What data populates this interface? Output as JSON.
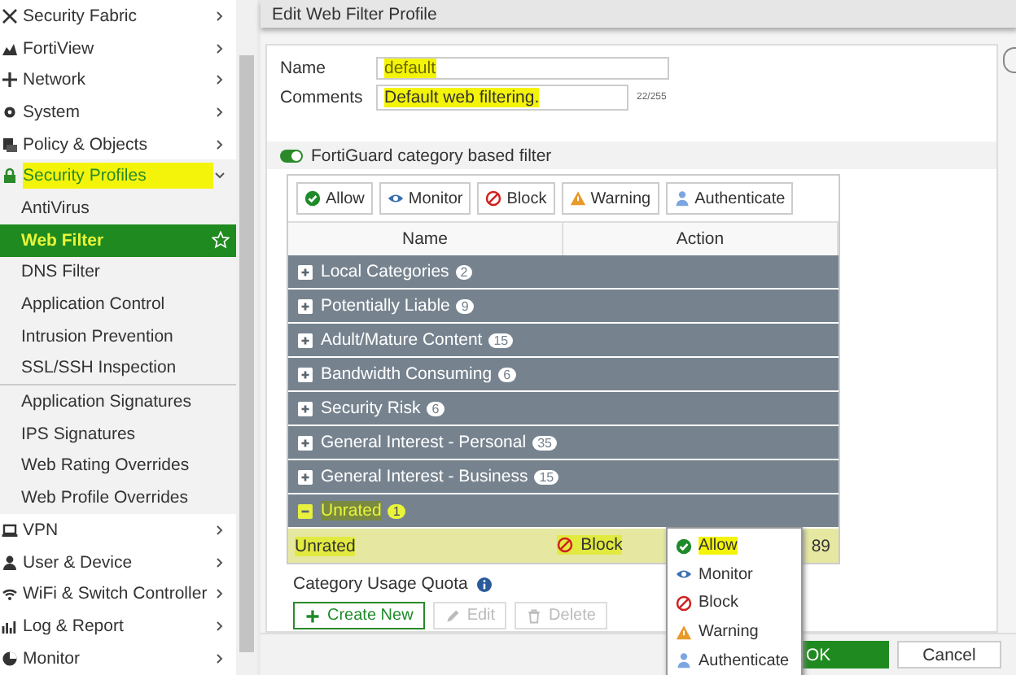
{
  "sidebar": {
    "items": [
      {
        "label": "Security Fabric",
        "expanded": false,
        "highlighted": false
      },
      {
        "label": "FortiView",
        "expanded": false,
        "highlighted": false
      },
      {
        "label": "Network",
        "expanded": false,
        "highlighted": false
      },
      {
        "label": "System",
        "expanded": false,
        "highlighted": false
      },
      {
        "label": "Policy & Objects",
        "expanded": false,
        "highlighted": false
      },
      {
        "label": "Security Profiles",
        "expanded": true,
        "highlighted": true,
        "children": [
          {
            "label": "AntiVirus",
            "selected": false,
            "highlighted": false,
            "separator_before": false
          },
          {
            "label": "Web Filter",
            "selected": true,
            "highlighted": true,
            "separator_before": false
          },
          {
            "label": "DNS Filter",
            "selected": false,
            "highlighted": false,
            "separator_before": false
          },
          {
            "label": "Application Control",
            "selected": false,
            "highlighted": false,
            "separator_before": false
          },
          {
            "label": "Intrusion Prevention",
            "selected": false,
            "highlighted": false,
            "separator_before": false
          },
          {
            "label": "SSL/SSH Inspection",
            "selected": false,
            "highlighted": false,
            "separator_before": false
          },
          {
            "label": "Application Signatures",
            "selected": false,
            "highlighted": false,
            "separator_before": true
          },
          {
            "label": "IPS Signatures",
            "selected": false,
            "highlighted": false,
            "separator_before": false
          },
          {
            "label": "Web Rating Overrides",
            "selected": false,
            "highlighted": false,
            "separator_before": false
          },
          {
            "label": "Web Profile Overrides",
            "selected": false,
            "highlighted": false,
            "separator_before": false
          }
        ]
      },
      {
        "label": "VPN",
        "expanded": false,
        "highlighted": false
      },
      {
        "label": "User & Device",
        "expanded": false,
        "highlighted": false
      },
      {
        "label": "WiFi & Switch Controller",
        "expanded": false,
        "highlighted": false
      },
      {
        "label": "Log & Report",
        "expanded": false,
        "highlighted": false
      },
      {
        "label": "Monitor",
        "expanded": false,
        "highlighted": false
      }
    ]
  },
  "window": {
    "title": "Edit Web Filter Profile"
  },
  "form": {
    "name": {
      "label": "Name",
      "value": "default",
      "highlighted": true
    },
    "comments": {
      "label": "Comments",
      "value": "Default web filtering.",
      "highlighted": true,
      "counter": "22/255"
    }
  },
  "filter_toggle": {
    "label": "FortiGuard category based filter",
    "on": true
  },
  "action_buttons": [
    {
      "kind": "allow",
      "label": "Allow"
    },
    {
      "kind": "monitor",
      "label": "Monitor"
    },
    {
      "kind": "block",
      "label": "Block"
    },
    {
      "kind": "warning",
      "label": "Warning"
    },
    {
      "kind": "authenticate",
      "label": "Authenticate"
    }
  ],
  "table": {
    "columns": [
      "Name",
      "Action"
    ],
    "groups": [
      {
        "name": "Local Categories",
        "count": "2",
        "expanded": false,
        "highlighted": false
      },
      {
        "name": "Potentially Liable",
        "count": "9",
        "expanded": false,
        "highlighted": false
      },
      {
        "name": "Adult/Mature Content",
        "count": "15",
        "expanded": false,
        "highlighted": false
      },
      {
        "name": "Bandwidth Consuming",
        "count": "6",
        "expanded": false,
        "highlighted": false
      },
      {
        "name": "Security Risk",
        "count": "6",
        "expanded": false,
        "highlighted": false
      },
      {
        "name": "General Interest - Personal",
        "count": "35",
        "expanded": false,
        "highlighted": false
      },
      {
        "name": "General Interest - Business",
        "count": "15",
        "expanded": false,
        "highlighted": false
      },
      {
        "name": "Unrated",
        "count": "1",
        "expanded": true,
        "highlighted": true,
        "children": [
          {
            "name": "Unrated",
            "action": {
              "kind": "block",
              "label": "Block"
            },
            "column_3": "89",
            "highlighted": true
          }
        ]
      }
    ]
  },
  "action_menu": {
    "items": [
      {
        "kind": "allow",
        "label": "Allow",
        "selected": true
      },
      {
        "kind": "monitor",
        "label": "Monitor",
        "selected": false
      },
      {
        "kind": "block",
        "label": "Block",
        "selected": false
      },
      {
        "kind": "warning",
        "label": "Warning",
        "selected": false
      },
      {
        "kind": "authenticate",
        "label": "Authenticate",
        "selected": false
      }
    ]
  },
  "quota": {
    "label": "Category Usage Quota",
    "buttons": [
      {
        "label": "Create New",
        "disabled": false
      },
      {
        "label": "Edit",
        "disabled": true
      },
      {
        "label": "Delete",
        "disabled": true
      }
    ]
  },
  "footer": {
    "buttons": [
      {
        "label": "OK",
        "primary": true
      },
      {
        "label": "Cancel",
        "primary": false
      }
    ]
  }
}
